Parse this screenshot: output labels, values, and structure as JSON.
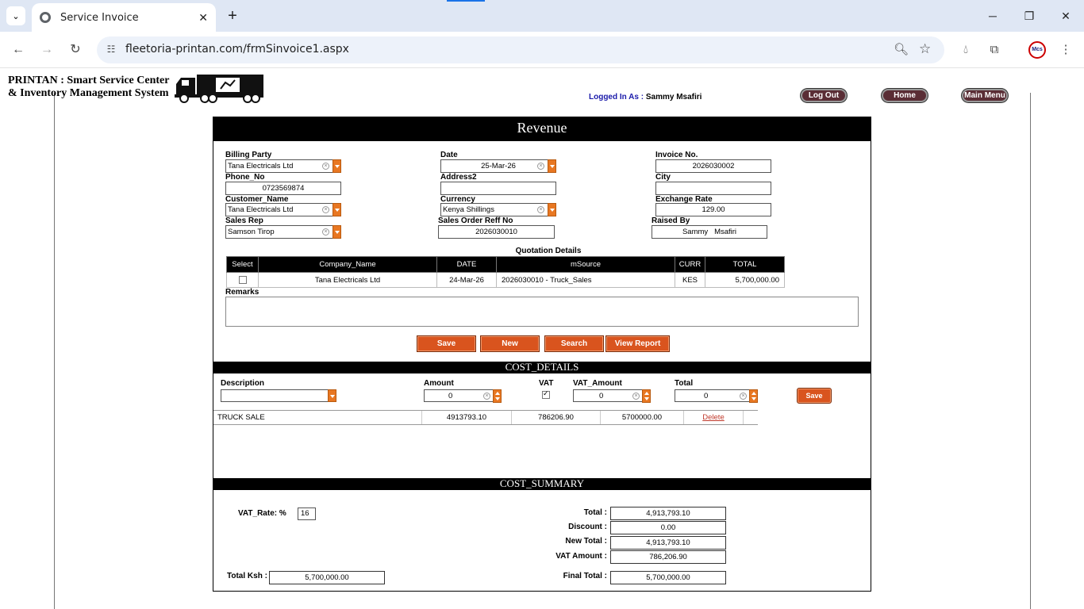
{
  "browser": {
    "tab_title": "Service Invoice",
    "url": "fleetoria-printan.com/frmSinvoice1.aspx",
    "profile_label": "Mcs"
  },
  "header": {
    "brand_line1": "PRINTAN : Smart Service Center",
    "brand_line2": "& Inventory Management System",
    "logged_label": "Logged In As :",
    "logged_user": "Sammy Msafiri",
    "logout_label": "Log Out",
    "home_label": "Home",
    "main_menu_label": "Main Menu"
  },
  "revenue": {
    "title": "Revenue",
    "billing_party_label": "Billing Party",
    "billing_party_value": "Tana Electricals Ltd",
    "date_label": "Date",
    "date_value": "25-Mar-26",
    "invoice_no_label": "Invoice No.",
    "invoice_no_value": "2026030002",
    "phone_label": "Phone_No",
    "phone_value": "0723569874",
    "address2_label": "Address2",
    "address2_value": "",
    "city_label": "City",
    "city_value": "",
    "customer_label": "Customer_Name",
    "customer_value": "Tana Electricals Ltd",
    "currency_label": "Currency",
    "currency_value": "Kenya Shillings",
    "exchange_label": "Exchange Rate",
    "exchange_value": "129.00",
    "sales_rep_label": "Sales Rep",
    "sales_rep_value": "Samson Tirop",
    "sales_order_label": "Sales Order Reff No",
    "sales_order_value": "2026030010",
    "raised_by_label": "Raised By",
    "raised_by_value": "Sammy   Msafiri",
    "quotation_title": "Quotation Details",
    "quotation_columns": [
      "Select",
      "Company_Name",
      "DATE",
      "mSource",
      "CURR",
      "TOTAL"
    ],
    "quotation_rows": [
      {
        "company": "Tana Electricals Ltd",
        "date": "24-Mar-26",
        "source": "2026030010 - Truck_Sales",
        "curr": "KES",
        "total": "5,700,000.00"
      }
    ],
    "remarks_label": "Remarks",
    "save_label": "Save",
    "new_label": "New",
    "search_label": "Search",
    "view_report_label": "View Report"
  },
  "cost_details": {
    "title": "COST_DETAILS",
    "description_label": "Description",
    "amount_label": "Amount",
    "amount_value": "0",
    "vat_label": "VAT",
    "vat_amount_label": "VAT_Amount",
    "vat_amount_value": "0",
    "total_label": "Total",
    "total_value": "0",
    "save_label": "Save",
    "rows": [
      {
        "description": "TRUCK SALE",
        "amount": "4913793.10",
        "vat": "786206.90",
        "total": "5700000.00",
        "action": "Delete"
      }
    ]
  },
  "cost_summary": {
    "title": "COST_SUMMARY",
    "vat_rate_label": "VAT_Rate: %",
    "vat_rate_value": "16",
    "total_ksh_label": "Total Ksh :",
    "total_ksh_value": "5,700,000.00",
    "total_label": "Total :",
    "total_value": "4,913,793.10",
    "discount_label": "Discount :",
    "discount_value": "0.00",
    "new_total_label": "New Total :",
    "new_total_value": "4,913,793.10",
    "vat_amount_label": "VAT Amount :",
    "vat_amount_value": "786,206.90",
    "final_total_label": "Final Total :",
    "final_total_value": "5,700,000.00"
  },
  "colors": {
    "orange_button": "#d9541e",
    "header_button": "#5a2d35",
    "band": "#000000"
  }
}
